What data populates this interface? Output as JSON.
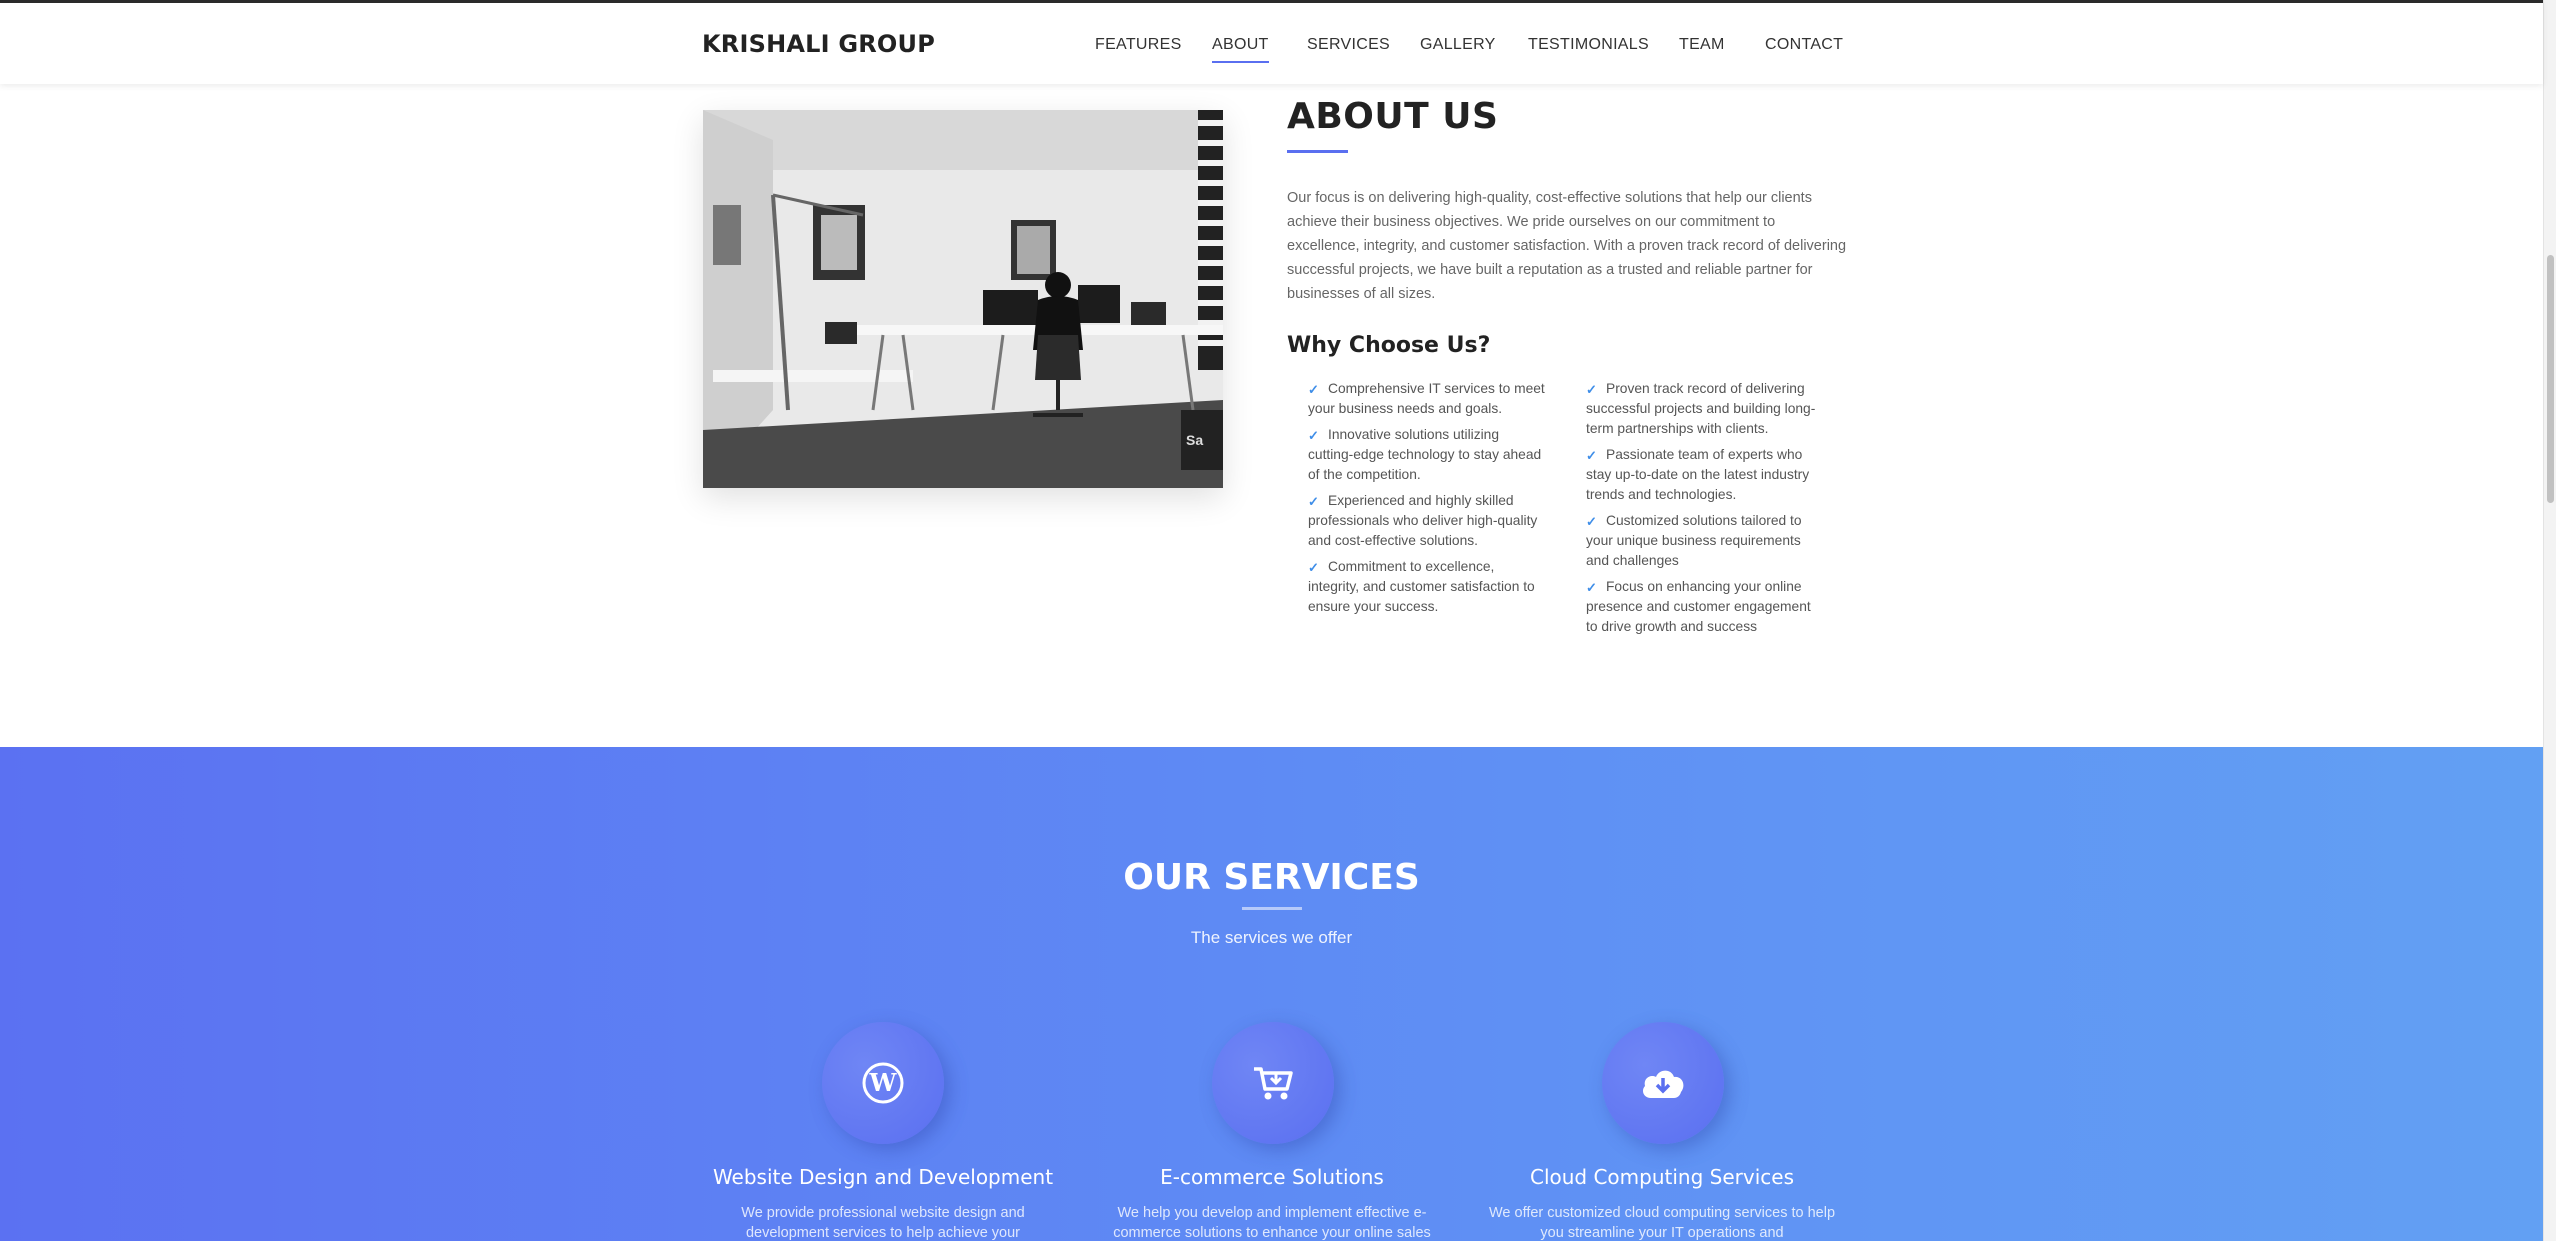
{
  "nav": {
    "brand": "KRISHALI GROUP",
    "items": [
      "FEATURES",
      "ABOUT",
      "SERVICES",
      "GALLERY",
      "TESTIMONIALS",
      "TEAM",
      "CONTACT"
    ],
    "active": "ABOUT"
  },
  "about": {
    "title": "ABOUT US",
    "text": "Our focus is on delivering high-quality, cost-effective solutions that help our clients achieve their business objectives. We pride ourselves on our commitment to excellence, integrity, and customer satisfaction. With a proven track record of delivering successful projects, we have built a reputation as a trusted and reliable partner for businesses of all sizes.",
    "why_title": "Why Choose Us?",
    "why_left": [
      "Comprehensive IT services to meet your business needs and goals.",
      "Innovative solutions utilizing cutting-edge technology to stay ahead of the competition.",
      "Experienced and highly skilled professionals who deliver high-quality and cost-effective solutions.",
      "Commitment to excellence, integrity, and customer satisfaction to ensure your success."
    ],
    "why_right": [
      "Proven track record of delivering successful projects and building long-term partnerships with clients.",
      "Passionate team of experts who stay up-to-date on the latest industry trends and technologies.",
      "Customized solutions tailored to your unique business requirements and challenges",
      "Focus on enhancing your online presence and customer engagement to drive growth and success"
    ],
    "image_icon": "workspace-photo"
  },
  "services": {
    "title": "OUR SERVICES",
    "subtitle": "The services we offer",
    "items": [
      {
        "icon": "wordpress-icon",
        "title": "Website Design and Development",
        "text": "We provide professional website design and development services to help achieve your"
      },
      {
        "icon": "cart-icon",
        "title": "E-commerce Solutions",
        "text": "We help you develop and implement effective e-commerce solutions to enhance your online sales"
      },
      {
        "icon": "cloud-download-icon",
        "title": "Cloud Computing Services",
        "text": "We offer customized cloud computing services to help you streamline your IT operations and"
      }
    ]
  },
  "colors": {
    "accent": "#5a6ff0",
    "check": "#3f8ee8",
    "services_gradient_start": "#5b71f2",
    "services_gradient_end": "#62a0f3"
  }
}
